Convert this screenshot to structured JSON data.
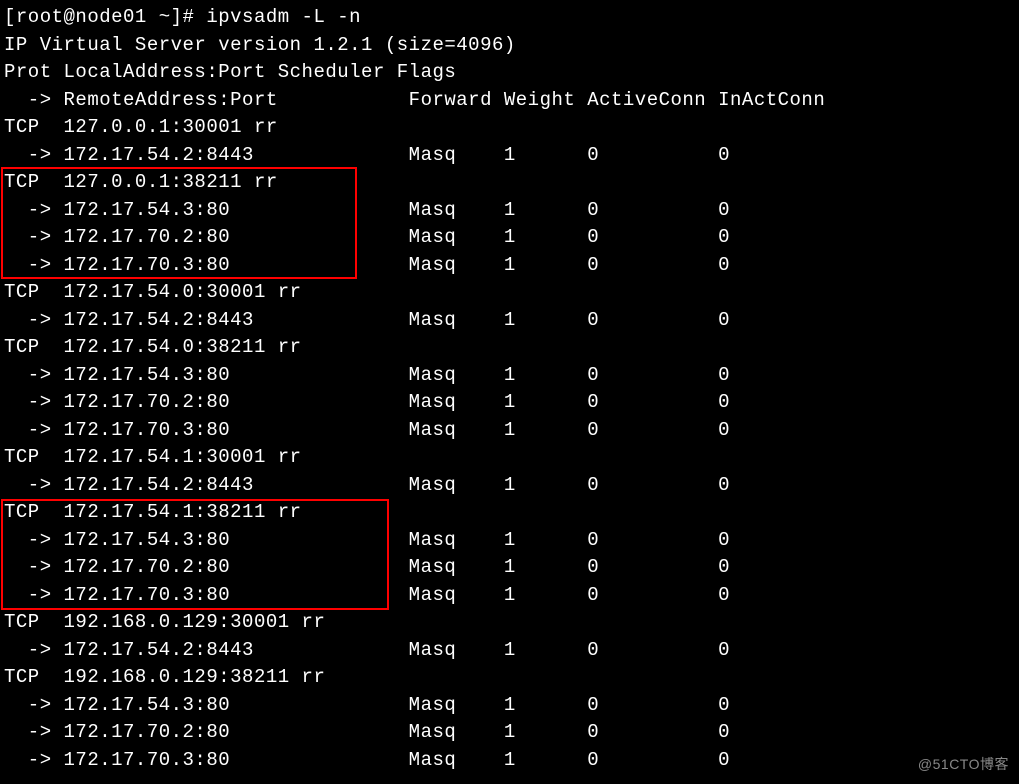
{
  "prompt": "[root@node01 ~]# ipvsadm -L -n",
  "version": "IP Virtual Server version 1.2.1 (size=4096)",
  "header1": "Prot LocalAddress:Port Scheduler Flags",
  "header2": "  -> RemoteAddress:Port           Forward Weight ActiveConn InActConn",
  "services": [
    {
      "svc": "TCP  127.0.0.1:30001 rr",
      "reals": [
        {
          "addr": "172.17.54.2:8443",
          "fwd": "Masq",
          "w": "1",
          "ac": "0",
          "ic": "0"
        }
      ]
    },
    {
      "svc": "TCP  127.0.0.1:38211 rr",
      "reals": [
        {
          "addr": "172.17.54.3:80",
          "fwd": "Masq",
          "w": "1",
          "ac": "0",
          "ic": "0"
        },
        {
          "addr": "172.17.70.2:80",
          "fwd": "Masq",
          "w": "1",
          "ac": "0",
          "ic": "0"
        },
        {
          "addr": "172.17.70.3:80",
          "fwd": "Masq",
          "w": "1",
          "ac": "0",
          "ic": "0"
        }
      ]
    },
    {
      "svc": "TCP  172.17.54.0:30001 rr",
      "reals": [
        {
          "addr": "172.17.54.2:8443",
          "fwd": "Masq",
          "w": "1",
          "ac": "0",
          "ic": "0"
        }
      ]
    },
    {
      "svc": "TCP  172.17.54.0:38211 rr",
      "reals": [
        {
          "addr": "172.17.54.3:80",
          "fwd": "Masq",
          "w": "1",
          "ac": "0",
          "ic": "0"
        },
        {
          "addr": "172.17.70.2:80",
          "fwd": "Masq",
          "w": "1",
          "ac": "0",
          "ic": "0"
        },
        {
          "addr": "172.17.70.3:80",
          "fwd": "Masq",
          "w": "1",
          "ac": "0",
          "ic": "0"
        }
      ]
    },
    {
      "svc": "TCP  172.17.54.1:30001 rr",
      "reals": [
        {
          "addr": "172.17.54.2:8443",
          "fwd": "Masq",
          "w": "1",
          "ac": "0",
          "ic": "0"
        }
      ]
    },
    {
      "svc": "TCP  172.17.54.1:38211 rr",
      "reals": [
        {
          "addr": "172.17.54.3:80",
          "fwd": "Masq",
          "w": "1",
          "ac": "0",
          "ic": "0"
        },
        {
          "addr": "172.17.70.2:80",
          "fwd": "Masq",
          "w": "1",
          "ac": "0",
          "ic": "0"
        },
        {
          "addr": "172.17.70.3:80",
          "fwd": "Masq",
          "w": "1",
          "ac": "0",
          "ic": "0"
        }
      ]
    },
    {
      "svc": "TCP  192.168.0.129:30001 rr",
      "reals": [
        {
          "addr": "172.17.54.2:8443",
          "fwd": "Masq",
          "w": "1",
          "ac": "0",
          "ic": "0"
        }
      ]
    },
    {
      "svc": "TCP  192.168.0.129:38211 rr",
      "reals": [
        {
          "addr": "172.17.54.3:80",
          "fwd": "Masq",
          "w": "1",
          "ac": "0",
          "ic": "0"
        },
        {
          "addr": "172.17.70.2:80",
          "fwd": "Masq",
          "w": "1",
          "ac": "0",
          "ic": "0"
        },
        {
          "addr": "172.17.70.3:80",
          "fwd": "Masq",
          "w": "1",
          "ac": "0",
          "ic": "0"
        }
      ]
    }
  ],
  "watermark": "@51CTO博客"
}
